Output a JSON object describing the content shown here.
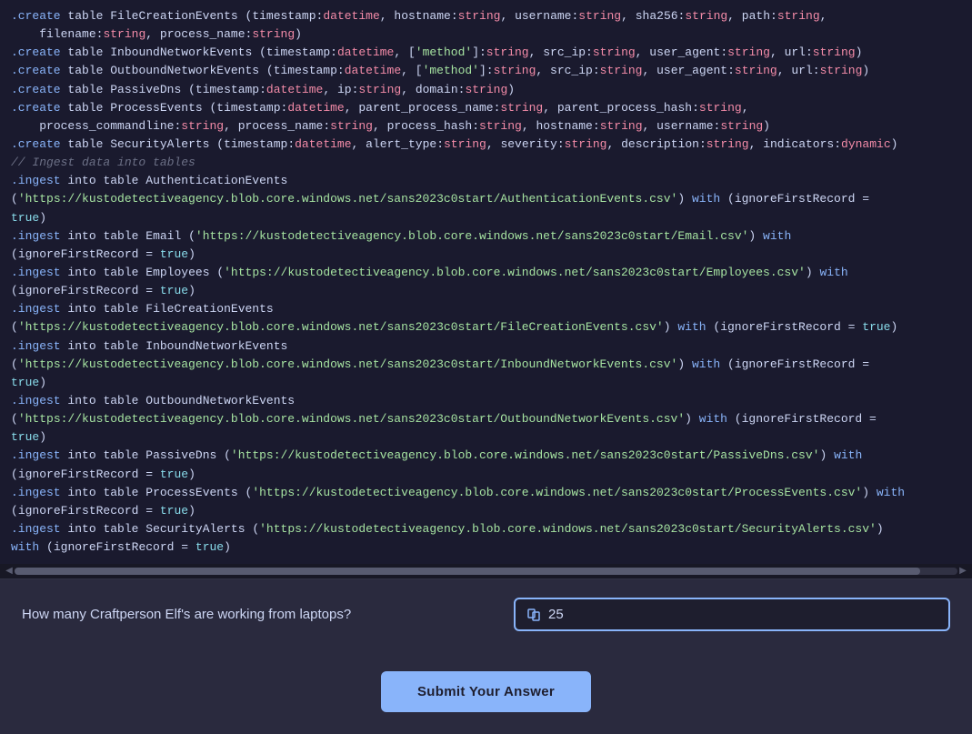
{
  "code": {
    "lines": [
      {
        "id": "line1",
        "content": ".create table FileCreationEvents (timestamp:datetime, hostname:string, username:string, sha256:string, path:string,",
        "type": "mixed"
      },
      {
        "id": "line2",
        "content": "    filename:string, process_name:string)",
        "type": "mixed"
      },
      {
        "id": "line3",
        "content": ".create table InboundNetworkEvents (timestamp:datetime, ['method']:string, src_ip:string, user_agent:string, url:string)",
        "type": "mixed"
      },
      {
        "id": "line4",
        "content": ".create table OutboundNetworkEvents (timestamp:datetime, ['method']:string, src_ip:string, user_agent:string, url:string)",
        "type": "mixed"
      },
      {
        "id": "line5",
        "content": ".create table PassiveDns (timestamp:datetime, ip:string, domain:string)",
        "type": "mixed"
      },
      {
        "id": "line6",
        "content": ".create table ProcessEvents (timestamp:datetime, parent_process_name:string, parent_process_hash:string,",
        "type": "mixed"
      },
      {
        "id": "line7",
        "content": "    process_commandline:string, process_name:string, process_hash:string, hostname:string, username:string)",
        "type": "mixed"
      },
      {
        "id": "line8",
        "content": ".create table SecurityAlerts (timestamp:datetime, alert_type:string, severity:string, description:string, indicators:dynamic)",
        "type": "mixed"
      },
      {
        "id": "line9",
        "content": "// Ingest data into tables",
        "type": "comment"
      },
      {
        "id": "line10",
        "content": ".ingest into table AuthenticationEvents",
        "type": "mixed"
      },
      {
        "id": "line11",
        "content": "('https://kustodetectiveagency.blob.core.windows.net/sans2023c0start/AuthenticationEvents.csv') with (ignoreFirstRecord =",
        "type": "mixed_str"
      },
      {
        "id": "line12",
        "content": "true)",
        "type": "bool_line"
      },
      {
        "id": "line13",
        "content": ".ingest into table Email ('https://kustodetectiveagency.blob.core.windows.net/sans2023c0start/Email.csv') with",
        "type": "mixed_str"
      },
      {
        "id": "line14",
        "content": "(ignoreFirstRecord = true)",
        "type": "bool_line"
      },
      {
        "id": "line15",
        "content": ".ingest into table Employees ('https://kustodetectiveagency.blob.core.windows.net/sans2023c0start/Employees.csv') with",
        "type": "mixed_str"
      },
      {
        "id": "line16",
        "content": "(ignoreFirstRecord = true)",
        "type": "bool_line"
      },
      {
        "id": "line17",
        "content": ".ingest into table FileCreationEvents",
        "type": "mixed"
      },
      {
        "id": "line18",
        "content": "('https://kustodetectiveagency.blob.core.windows.net/sans2023c0start/FileCreationEvents.csv') with (ignoreFirstRecord = true)",
        "type": "mixed_str_bool"
      },
      {
        "id": "line19",
        "content": ".ingest into table InboundNetworkEvents",
        "type": "mixed"
      },
      {
        "id": "line20",
        "content": "('https://kustodetectiveagency.blob.core.windows.net/sans2023c0start/InboundNetworkEvents.csv') with (ignoreFirstRecord =",
        "type": "mixed_str"
      },
      {
        "id": "line21",
        "content": "true)",
        "type": "bool_line"
      },
      {
        "id": "line22",
        "content": ".ingest into table OutboundNetworkEvents",
        "type": "mixed"
      },
      {
        "id": "line23",
        "content": "('https://kustodetectiveagency.blob.core.windows.net/sans2023c0start/OutboundNetworkEvents.csv') with (ignoreFirstRecord =",
        "type": "mixed_str"
      },
      {
        "id": "line24",
        "content": "true)",
        "type": "bool_line"
      },
      {
        "id": "line25",
        "content": ".ingest into table PassiveDns ('https://kustodetectiveagency.blob.core.windows.net/sans2023c0start/PassiveDns.csv') with",
        "type": "mixed_str"
      },
      {
        "id": "line26",
        "content": "(ignoreFirstRecord = true)",
        "type": "bool_line"
      },
      {
        "id": "line27",
        "content": ".ingest into table ProcessEvents ('https://kustodetectiveagency.blob.core.windows.net/sans2023c0start/ProcessEvents.csv') with",
        "type": "mixed_str"
      },
      {
        "id": "line28",
        "content": "(ignoreFirstRecord = true)",
        "type": "bool_line"
      },
      {
        "id": "line29",
        "content": ".ingest into table SecurityAlerts ('https://kustodetectiveagency.blob.core.windows.net/sans2023c0start/SecurityAlerts.csv')",
        "type": "mixed_str"
      },
      {
        "id": "line30",
        "content": "with (ignoreFirstRecord = true)",
        "type": "bool_line_with"
      }
    ]
  },
  "question": {
    "text": "How many Craftperson Elf's are working from laptops?",
    "answer_value": "25",
    "answer_placeholder": "25"
  },
  "submit_button": {
    "label": "Submit Your Answer"
  }
}
